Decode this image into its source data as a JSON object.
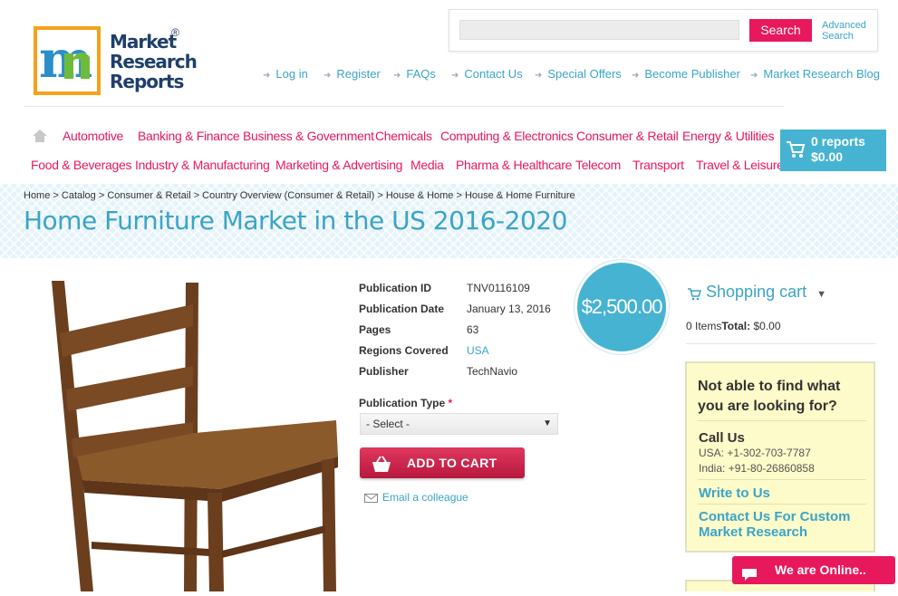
{
  "logo": {
    "line1": "Market",
    "line2": "Research",
    "line3": "Reports",
    "reg": "®"
  },
  "search": {
    "placeholder": "",
    "button_label": "Search",
    "advanced_line1": "Advanced",
    "advanced_line2": "Search"
  },
  "top_links": [
    "Log in",
    "Register",
    "FAQs",
    "Contact Us",
    "Special Offers",
    "Become Publisher",
    "Market Research Blog"
  ],
  "categories_row1": [
    "Automotive",
    "Banking & Finance",
    "Business & Government",
    "Chemicals",
    "Computing & Electronics",
    "Consumer & Retail",
    "Energy & Utilities"
  ],
  "categories_row2": [
    "Food & Beverages",
    "Industry & Manufacturing",
    "Marketing & Advertising",
    "Media",
    "Pharma & Healthcare",
    "Telecom",
    "Transport",
    "Travel & Leisure"
  ],
  "cart": {
    "reports": "0 reports",
    "total": "$0.00"
  },
  "breadcrumb": "Home > Catalog > Consumer & Retail > Country Overview (Consumer & Retail) > House & Home > House & Home Furniture",
  "page_title": "Home Furniture Market in the US 2016-2020",
  "product": {
    "info": [
      {
        "label": "Publication ID",
        "value": "TNV0116109"
      },
      {
        "label": "Publication Date",
        "value": "January 13, 2016"
      },
      {
        "label": "Pages",
        "value": "63"
      },
      {
        "label": "Regions Covered",
        "value": "USA"
      },
      {
        "label": "Publisher",
        "value": "TechNavio"
      }
    ],
    "price": "$2,500.00",
    "publication_type_label": "Publication Type",
    "required_mark": "*",
    "select_value": "- Select -",
    "add_to_cart": "ADD TO CART",
    "email_colleague": "Email a colleague"
  },
  "sidebar": {
    "shopping_cart_title": "Shopping cart",
    "items_label": "0 Items",
    "total_label": "Total:",
    "total_value": " $0.00",
    "help_question": "Not able to find what you are looking for?",
    "call_us": "Call Us",
    "phone_usa": "USA: +1-302-703-7787",
    "phone_india": "India: +91-80-26860858",
    "write_to_us": "Write to Us",
    "contact_custom": "Contact Us For Custom Market Research"
  },
  "chat": {
    "label": "We are Online.."
  },
  "colors": {
    "accent_pink": "#e8185d",
    "accent_blue": "#3aa4c8",
    "cart_blue": "#46b3d2",
    "help_bg": "#fdfbc9"
  }
}
